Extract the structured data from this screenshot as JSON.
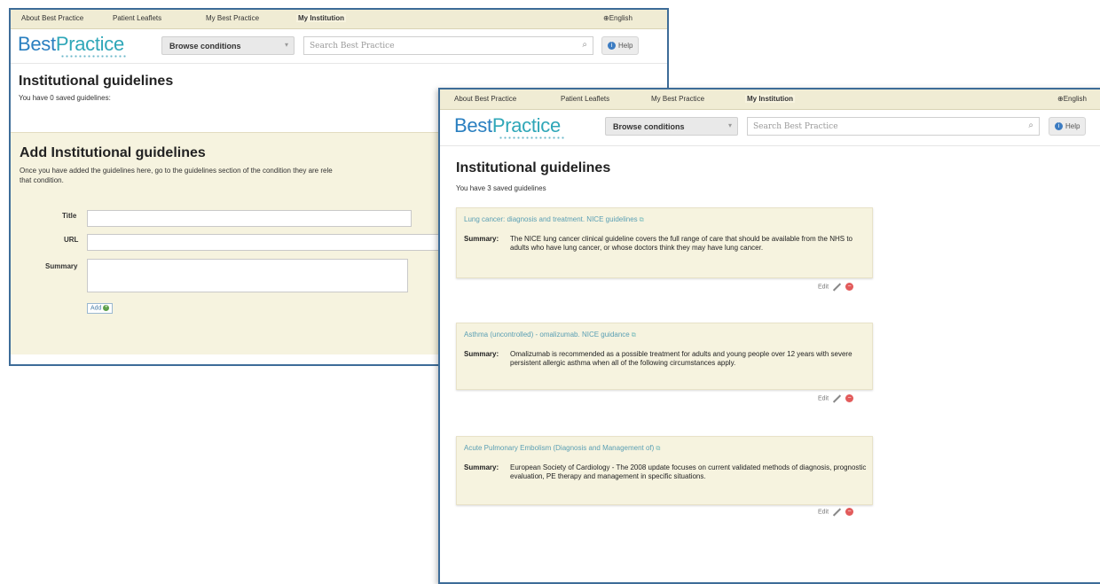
{
  "nav": {
    "tabs": [
      "About Best Practice",
      "Patient Leaflets",
      "My Best Practice",
      "My Institution"
    ],
    "active_tab": "My Institution",
    "language": "English"
  },
  "header": {
    "logo_part1": "Best",
    "logo_part2": "Practice",
    "browse_label": "Browse conditions",
    "search_placeholder": "Search Best Practice",
    "help_label": "Help"
  },
  "window_back": {
    "page_title": "Institutional guidelines",
    "saved_count_text": "You have 0 saved guidelines:",
    "add_title": "Add Institutional guidelines",
    "add_desc": "Once you have added the guidelines here, go to the guidelines section of the condition they are rele",
    "add_desc_cont": "that condition.",
    "field_title_label": "Title",
    "field_url_label": "URL",
    "field_summary_label": "Summary",
    "add_button_label": "Add"
  },
  "window_front": {
    "page_title": "Institutional guidelines",
    "saved_count_text": "You have 3 saved guidelines",
    "language": "English",
    "guidelines": [
      {
        "title": "Lung cancer: diagnosis and treatment. NICE guidelines",
        "summary_label": "Summary:",
        "summary": "The NICE lung cancer clinical guideline covers the full range of care that should be available from the NHS to adults who have lung cancer, or whose doctors think they may have lung cancer.",
        "edit_label": "Edit"
      },
      {
        "title": "Asthma (uncontrolled) - omalizumab. NICE guidance",
        "summary_label": "Summary:",
        "summary": "Omalizumab is recommended as a possible treatment for adults and young people over 12 years with severe persistent allergic asthma when all of the following circumstances apply.",
        "edit_label": "Edit"
      },
      {
        "title": "Acute Pulmonary Embolism (Diagnosis and Management of)",
        "summary_label": "Summary:",
        "summary": "European Society of Cardiology - The 2008 update focuses on current validated methods of diagnosis, prognostic evaluation, PE therapy and management in specific situations.",
        "edit_label": "Edit"
      }
    ]
  },
  "colors": {
    "window_border": "#3d6c98",
    "panel_bg": "#f6f3df",
    "link": "#5a9fb4",
    "logo_blue": "#2a7fc0",
    "delete_red": "#e25b5b"
  }
}
